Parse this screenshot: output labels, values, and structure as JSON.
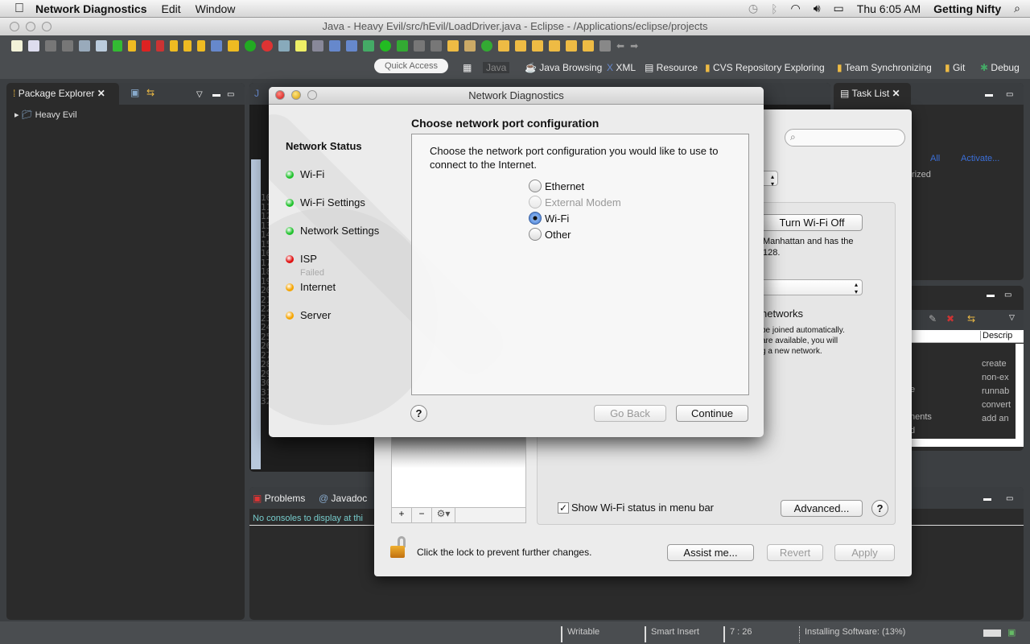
{
  "menubar": {
    "app": "Network Diagnostics",
    "items": [
      "Edit",
      "Window"
    ],
    "clock": "Thu 6:05 AM",
    "user": "Getting Nifty"
  },
  "eclipse": {
    "title": "Java - Heavy Evil/src/hEvil/LoadDriver.java - Eclipse - /Applications/eclipse/projects",
    "quick_access": "Quick Access",
    "perspectives": [
      "Java",
      "Java Browsing",
      "XML",
      "Resource",
      "CVS Repository Exploring",
      "Team Synchronizing",
      "Git",
      "Debug"
    ],
    "package_explorer": {
      "tab": "Package Explorer",
      "items": [
        "Heavy Evil"
      ]
    },
    "task_list": {
      "tab": "Task List",
      "links": [
        "All",
        "Activate..."
      ],
      "partial": "rized"
    },
    "line_numbers": [
      "10",
      "11",
      "12",
      "13",
      "14",
      "15",
      "16",
      "17",
      "18",
      "19",
      "20",
      "21",
      "22",
      "23",
      "24",
      "25",
      "26",
      "27",
      "28",
      "29",
      "30",
      "31",
      "32"
    ],
    "problems_tabs": [
      "Problems",
      "Javadoc"
    ],
    "console_msg": "No consoles to display at thi",
    "table": {
      "header": "Descrip",
      "rows": [
        "create",
        "non-ex",
        "runnab",
        "convert",
        "add an"
      ],
      "left_partial": [
        "e",
        "nents",
        "d"
      ]
    },
    "status": {
      "writable": "Writable",
      "insert": "Smart Insert",
      "position": "7 : 26",
      "progress": "Installing Software: (13%)"
    }
  },
  "prefs": {
    "turn_wifi": "Turn Wi-Fi Off",
    "wifi_text": [
      "Manhattan and has the",
      "128."
    ],
    "networks_heading": "networks",
    "networks_text": [
      "be joined automatically.",
      "are available, you will",
      "g a new network."
    ],
    "show_status": "Show Wi-Fi status in menu bar",
    "show_status_checked": true,
    "advanced": "Advanced...",
    "help": "?",
    "list_buttons": [
      "+",
      "−",
      "⚙▾"
    ],
    "lock_text": "Click the lock to prevent further changes.",
    "assist": "Assist me...",
    "revert": "Revert",
    "apply": "Apply"
  },
  "diagnostics": {
    "title": "Network Diagnostics",
    "sidebar_title": "Network Status",
    "status_items": [
      {
        "label": "Wi-Fi",
        "color": "#22c22e"
      },
      {
        "label": "Wi-Fi Settings",
        "color": "#22c22e"
      },
      {
        "label": "Network Settings",
        "color": "#22c22e"
      },
      {
        "label": "ISP",
        "color": "#e01010",
        "sub": "Failed"
      },
      {
        "label": "Internet",
        "color": "#f5a400"
      },
      {
        "label": "Server",
        "color": "#f5a400"
      }
    ],
    "heading": "Choose network port configuration",
    "instructions": "Choose the network port configuration you would like to use to connect to the Internet.",
    "options": [
      {
        "label": "Ethernet",
        "selected": false,
        "disabled": false
      },
      {
        "label": "External Modem",
        "selected": false,
        "disabled": true
      },
      {
        "label": "Wi-Fi",
        "selected": true,
        "disabled": false
      },
      {
        "label": "Other",
        "selected": false,
        "disabled": false
      }
    ],
    "help": "?",
    "go_back": "Go Back",
    "continue": "Continue"
  }
}
